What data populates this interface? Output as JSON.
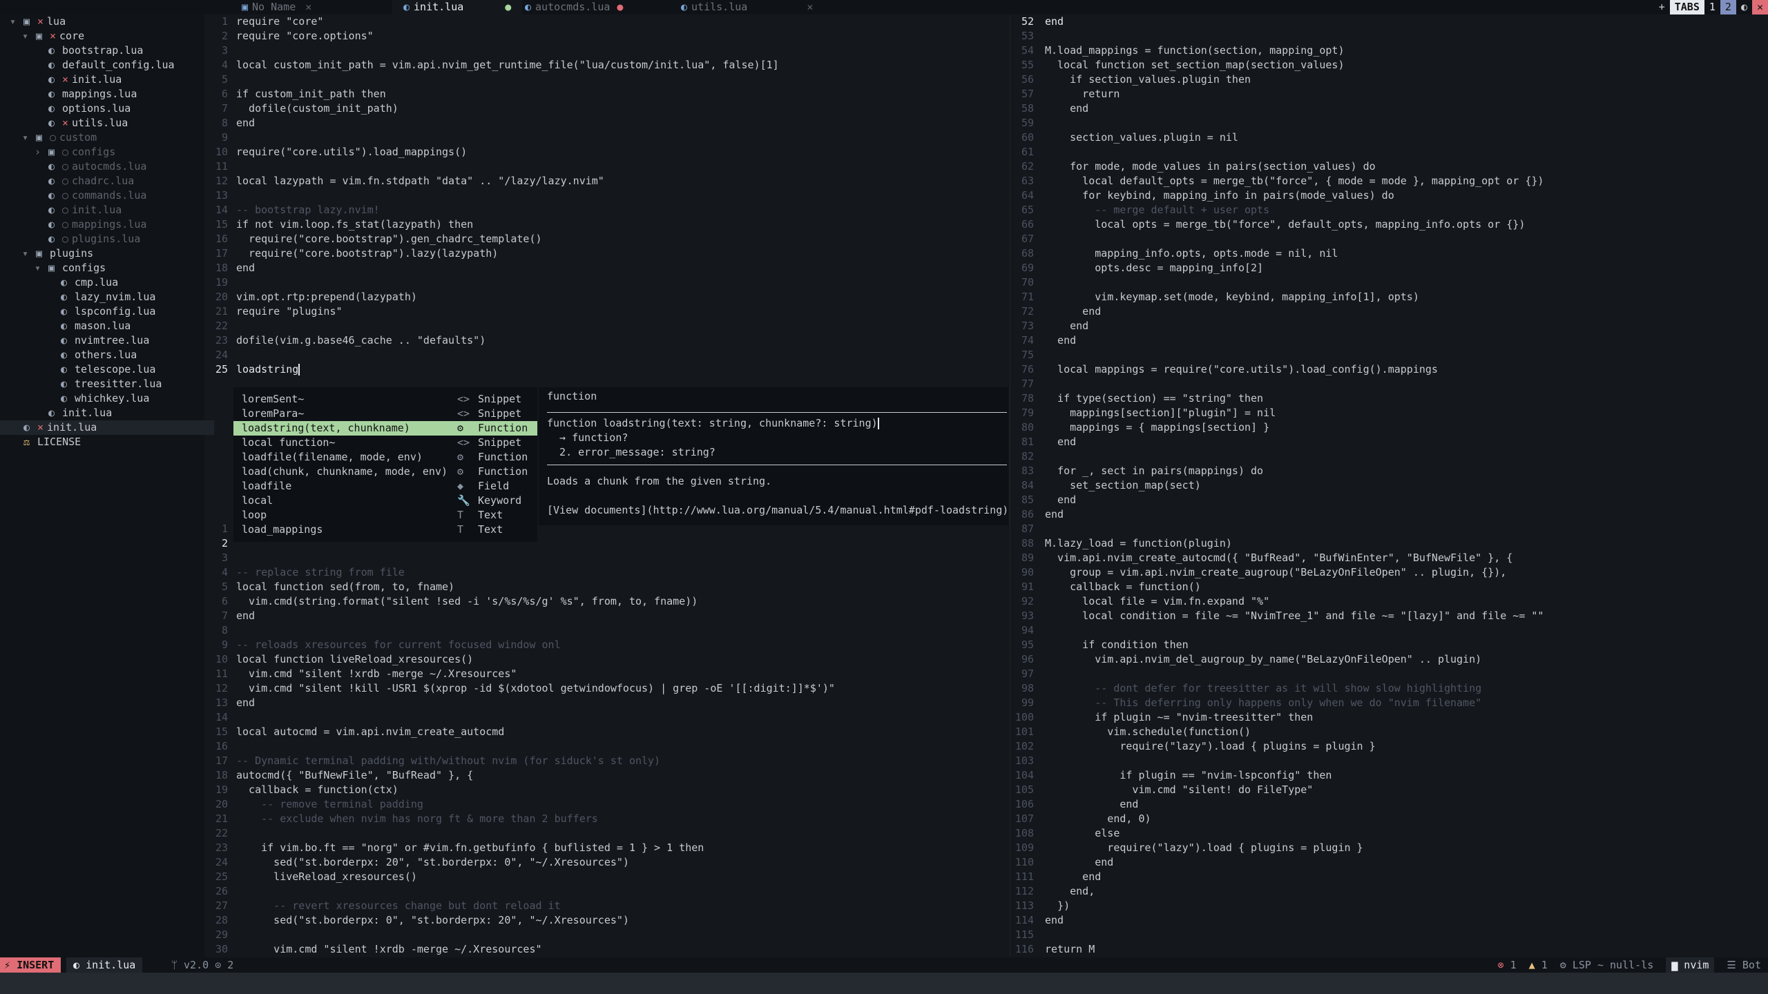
{
  "colors": {
    "background": "#14171c",
    "accent": "#a8d4a0",
    "error": "#e06c75",
    "warning": "#e5c07b",
    "insert_mode": "#e06c75"
  },
  "tabs": [
    {
      "label": "No Name",
      "icon": "empty-file-icon",
      "active": false,
      "modified": false
    },
    {
      "label": "init.lua",
      "icon": "lua-file-icon",
      "active": true,
      "modified": true
    },
    {
      "label": "autocmds.lua",
      "icon": "lua-file-icon",
      "active": false,
      "modified": true
    },
    {
      "label": "utils.lua",
      "icon": "lua-file-icon",
      "active": false,
      "modified": false
    }
  ],
  "tabline_right": {
    "new": "+",
    "tabs": "TABS",
    "tab1": "1",
    "tab2": "2",
    "toggle": "◐",
    "close": "✕"
  },
  "tree": [
    {
      "indent": 0,
      "chev": "▾",
      "icon": "folder-icon",
      "mod": "×",
      "label": "lua",
      "dim": false
    },
    {
      "indent": 1,
      "chev": "▾",
      "icon": "folder-icon",
      "mod": "×",
      "label": "core",
      "dim": false
    },
    {
      "indent": 2,
      "chev": "",
      "icon": "lua-file-icon",
      "mod": "",
      "label": "bootstrap.lua",
      "dim": false
    },
    {
      "indent": 2,
      "chev": "",
      "icon": "lua-file-icon",
      "mod": "",
      "label": "default_config.lua",
      "dim": false
    },
    {
      "indent": 2,
      "chev": "",
      "icon": "lua-file-icon",
      "mod": "×",
      "label": "init.lua",
      "dim": false
    },
    {
      "indent": 2,
      "chev": "",
      "icon": "lua-file-icon",
      "mod": "",
      "label": "mappings.lua",
      "dim": false
    },
    {
      "indent": 2,
      "chev": "",
      "icon": "lua-file-icon",
      "mod": "",
      "label": "options.lua",
      "dim": false
    },
    {
      "indent": 2,
      "chev": "",
      "icon": "lua-file-icon",
      "mod": "×",
      "label": "utils.lua",
      "dim": false
    },
    {
      "indent": 1,
      "chev": "▾",
      "icon": "folder-icon",
      "mod": "○",
      "label": "custom",
      "dim": true
    },
    {
      "indent": 2,
      "chev": "›",
      "icon": "folder-icon",
      "mod": "○",
      "label": "configs",
      "dim": true
    },
    {
      "indent": 2,
      "chev": "",
      "icon": "lua-file-icon",
      "mod": "○",
      "label": "autocmds.lua",
      "dim": true
    },
    {
      "indent": 2,
      "chev": "",
      "icon": "lua-file-icon",
      "mod": "○",
      "label": "chadrc.lua",
      "dim": true
    },
    {
      "indent": 2,
      "chev": "",
      "icon": "lua-file-icon",
      "mod": "○",
      "label": "commands.lua",
      "dim": true
    },
    {
      "indent": 2,
      "chev": "",
      "icon": "lua-file-icon",
      "mod": "○",
      "label": "init.lua",
      "dim": true
    },
    {
      "indent": 2,
      "chev": "",
      "icon": "lua-file-icon",
      "mod": "○",
      "label": "mappings.lua",
      "dim": true
    },
    {
      "indent": 2,
      "chev": "",
      "icon": "lua-file-icon",
      "mod": "○",
      "label": "plugins.lua",
      "dim": true
    },
    {
      "indent": 1,
      "chev": "▾",
      "icon": "folder-icon",
      "mod": "",
      "label": "plugins",
      "dim": false
    },
    {
      "indent": 2,
      "chev": "▾",
      "icon": "folder-icon",
      "mod": "",
      "label": "configs",
      "dim": false
    },
    {
      "indent": 3,
      "chev": "",
      "icon": "lua-file-icon",
      "mod": "",
      "label": "cmp.lua",
      "dim": false
    },
    {
      "indent": 3,
      "chev": "",
      "icon": "lua-file-icon",
      "mod": "",
      "label": "lazy_nvim.lua",
      "dim": false
    },
    {
      "indent": 3,
      "chev": "",
      "icon": "lua-file-icon",
      "mod": "",
      "label": "lspconfig.lua",
      "dim": false
    },
    {
      "indent": 3,
      "chev": "",
      "icon": "lua-file-icon",
      "mod": "",
      "label": "mason.lua",
      "dim": false
    },
    {
      "indent": 3,
      "chev": "",
      "icon": "lua-file-icon",
      "mod": "",
      "label": "nvimtree.lua",
      "dim": false
    },
    {
      "indent": 3,
      "chev": "",
      "icon": "lua-file-icon",
      "mod": "",
      "label": "others.lua",
      "dim": false
    },
    {
      "indent": 3,
      "chev": "",
      "icon": "lua-file-icon",
      "mod": "",
      "label": "telescope.lua",
      "dim": false
    },
    {
      "indent": 3,
      "chev": "",
      "icon": "lua-file-icon",
      "mod": "",
      "label": "treesitter.lua",
      "dim": false
    },
    {
      "indent": 3,
      "chev": "",
      "icon": "lua-file-icon",
      "mod": "",
      "label": "whichkey.lua",
      "dim": false
    },
    {
      "indent": 2,
      "chev": "",
      "icon": "lua-file-icon",
      "mod": "",
      "label": "init.lua",
      "dim": false
    },
    {
      "indent": 0,
      "chev": "",
      "icon": "lua-file-icon",
      "mod": "×",
      "label": "init.lua",
      "dim": false,
      "selected": true
    },
    {
      "indent": 0,
      "chev": "",
      "icon": "license-icon",
      "mod": "",
      "label": "LICENSE",
      "dim": false
    }
  ],
  "editor_top": {
    "lines": [
      {
        "n": "1",
        "text": "require \"core\""
      },
      {
        "n": "2",
        "text": "require \"core.options\""
      },
      {
        "n": "3",
        "text": ""
      },
      {
        "n": "4",
        "text": "local custom_init_path = vim.api.nvim_get_runtime_file(\"lua/custom/init.lua\", false)[1]"
      },
      {
        "n": "5",
        "text": ""
      },
      {
        "n": "6",
        "text": "if custom_init_path then"
      },
      {
        "n": "7",
        "text": "  dofile(custom_init_path)"
      },
      {
        "n": "8",
        "text": "end"
      },
      {
        "n": "9",
        "text": ""
      },
      {
        "n": "10",
        "text": "require(\"core.utils\").load_mappings()"
      },
      {
        "n": "11",
        "text": ""
      },
      {
        "n": "12",
        "text": "local lazypath = vim.fn.stdpath \"data\" .. \"/lazy/lazy.nvim\""
      },
      {
        "n": "13",
        "text": ""
      },
      {
        "n": "14",
        "text": "-- bootstrap lazy.nvim!",
        "comment": true
      },
      {
        "n": "15",
        "text": "if not vim.loop.fs_stat(lazypath) then"
      },
      {
        "n": "16",
        "text": "  require(\"core.bootstrap\").gen_chadrc_template()"
      },
      {
        "n": "17",
        "text": "  require(\"core.bootstrap\").lazy(lazypath)"
      },
      {
        "n": "18",
        "text": "end"
      },
      {
        "n": "19",
        "text": ""
      },
      {
        "n": "20",
        "text": "vim.opt.rtp:prepend(lazypath)"
      },
      {
        "n": "21",
        "text": "require \"plugins\""
      },
      {
        "n": "22",
        "text": ""
      },
      {
        "n": "23",
        "text": "dofile(vim.g.base46_cache .. \"defaults\")"
      },
      {
        "n": "24",
        "text": ""
      },
      {
        "n": "25",
        "text": "loadstring",
        "current": true
      }
    ]
  },
  "editor_bottom": {
    "lines": [
      {
        "n": "1",
        "text": ""
      },
      {
        "n": "2",
        "text": "",
        "current": true
      },
      {
        "n": "3",
        "text": ""
      },
      {
        "n": "4",
        "text": "-- replace string from file",
        "comment": true
      },
      {
        "n": "5",
        "text": "local function sed(from, to, fname)"
      },
      {
        "n": "6",
        "text": "  vim.cmd(string.format(\"silent !sed -i 's/%s/%s/g' %s\", from, to, fname))"
      },
      {
        "n": "7",
        "text": "end"
      },
      {
        "n": "8",
        "text": ""
      },
      {
        "n": "9",
        "text": "-- reloads xresources for current focused window onl",
        "comment": true
      },
      {
        "n": "10",
        "text": "local function liveReload_xresources()"
      },
      {
        "n": "11",
        "text": "  vim.cmd \"silent !xrdb -merge ~/.Xresources\""
      },
      {
        "n": "12",
        "text": "  vim.cmd \"silent !kill -USR1 $(xprop -id $(xdotool getwindowfocus) | grep -oE '[[:digit:]]*$')\""
      },
      {
        "n": "13",
        "text": "end"
      },
      {
        "n": "14",
        "text": ""
      },
      {
        "n": "15",
        "text": "local autocmd = vim.api.nvim_create_autocmd"
      },
      {
        "n": "16",
        "text": ""
      },
      {
        "n": "17",
        "text": "-- Dynamic terminal padding with/without nvim (for siduck's st only)",
        "comment": true
      },
      {
        "n": "18",
        "text": "autocmd({ \"BufNewFile\", \"BufRead\" }, {"
      },
      {
        "n": "19",
        "text": "  callback = function(ctx)"
      },
      {
        "n": "20",
        "text": "    -- remove terminal padding",
        "comment": true
      },
      {
        "n": "21",
        "text": "    -- exclude when nvim has norg ft & more than 2 buffers",
        "comment": true
      },
      {
        "n": "22",
        "text": ""
      },
      {
        "n": "23",
        "text": "    if vim.bo.ft == \"norg\" or #vim.fn.getbufinfo { buflisted = 1 } > 1 then"
      },
      {
        "n": "24",
        "text": "      sed(\"st.borderpx: 20\", \"st.borderpx: 0\", \"~/.Xresources\")"
      },
      {
        "n": "25",
        "text": "      liveReload_xresources()"
      },
      {
        "n": "26",
        "text": ""
      },
      {
        "n": "27",
        "text": "      -- revert xresources change but dont reload it",
        "comment": true
      },
      {
        "n": "28",
        "text": "      sed(\"st.borderpx: 0\", \"st.borderpx: 20\", \"~/.Xresources\")"
      },
      {
        "n": "29",
        "text": ""
      },
      {
        "n": "30",
        "text": "      vim.cmd \"silent !xrdb -merge ~/.Xresources\""
      }
    ]
  },
  "editor_right": {
    "lines": [
      {
        "n": "52",
        "text": "end",
        "current": true
      },
      {
        "n": "53",
        "text": ""
      },
      {
        "n": "54",
        "text": "M.load_mappings = function(section, mapping_opt)"
      },
      {
        "n": "55",
        "text": "  local function set_section_map(section_values)"
      },
      {
        "n": "56",
        "text": "    if section_values.plugin then"
      },
      {
        "n": "57",
        "text": "      return"
      },
      {
        "n": "58",
        "text": "    end"
      },
      {
        "n": "59",
        "text": ""
      },
      {
        "n": "60",
        "text": "    section_values.plugin = nil"
      },
      {
        "n": "61",
        "text": ""
      },
      {
        "n": "62",
        "text": "    for mode, mode_values in pairs(section_values) do"
      },
      {
        "n": "63",
        "text": "      local default_opts = merge_tb(\"force\", { mode = mode }, mapping_opt or {})"
      },
      {
        "n": "64",
        "text": "      for keybind, mapping_info in pairs(mode_values) do"
      },
      {
        "n": "65",
        "text": "        -- merge default + user opts",
        "comment": true
      },
      {
        "n": "66",
        "text": "        local opts = merge_tb(\"force\", default_opts, mapping_info.opts or {})"
      },
      {
        "n": "67",
        "text": ""
      },
      {
        "n": "68",
        "text": "        mapping_info.opts, opts.mode = nil, nil"
      },
      {
        "n": "69",
        "text": "        opts.desc = mapping_info[2]"
      },
      {
        "n": "70",
        "text": ""
      },
      {
        "n": "71",
        "text": "        vim.keymap.set(mode, keybind, mapping_info[1], opts)"
      },
      {
        "n": "72",
        "text": "      end"
      },
      {
        "n": "73",
        "text": "    end"
      },
      {
        "n": "74",
        "text": "  end"
      },
      {
        "n": "75",
        "text": ""
      },
      {
        "n": "76",
        "text": "  local mappings = require(\"core.utils\").load_config().mappings"
      },
      {
        "n": "77",
        "text": ""
      },
      {
        "n": "78",
        "text": "  if type(section) == \"string\" then"
      },
      {
        "n": "79",
        "text": "    mappings[section][\"plugin\"] = nil"
      },
      {
        "n": "80",
        "text": "    mappings = { mappings[section] }"
      },
      {
        "n": "81",
        "text": "  end"
      },
      {
        "n": "82",
        "text": ""
      },
      {
        "n": "83",
        "text": "  for _, sect in pairs(mappings) do"
      },
      {
        "n": "84",
        "text": "    set_section_map(sect)"
      },
      {
        "n": "85",
        "text": "  end"
      },
      {
        "n": "86",
        "text": "end"
      },
      {
        "n": "87",
        "text": ""
      },
      {
        "n": "88",
        "text": "M.lazy_load = function(plugin)"
      },
      {
        "n": "89",
        "text": "  vim.api.nvim_create_autocmd({ \"BufRead\", \"BufWinEnter\", \"BufNewFile\" }, {"
      },
      {
        "n": "90",
        "text": "    group = vim.api.nvim_create_augroup(\"BeLazyOnFileOpen\" .. plugin, {}),"
      },
      {
        "n": "91",
        "text": "    callback = function()"
      },
      {
        "n": "92",
        "text": "      local file = vim.fn.expand \"%\""
      },
      {
        "n": "93",
        "text": "      local condition = file ~= \"NvimTree_1\" and file ~= \"[lazy]\" and file ~= \"\""
      },
      {
        "n": "94",
        "text": ""
      },
      {
        "n": "95",
        "text": "      if condition then"
      },
      {
        "n": "96",
        "text": "        vim.api.nvim_del_augroup_by_name(\"BeLazyOnFileOpen\" .. plugin)"
      },
      {
        "n": "97",
        "text": ""
      },
      {
        "n": "98",
        "text": "        -- dont defer for treesitter as it will show slow highlighting",
        "comment": true
      },
      {
        "n": "99",
        "text": "        -- This deferring only happens only when we do \"nvim filename\"",
        "comment": true
      },
      {
        "n": "100",
        "text": "        if plugin ~= \"nvim-treesitter\" then"
      },
      {
        "n": "101",
        "text": "          vim.schedule(function()"
      },
      {
        "n": "102",
        "text": "            require(\"lazy\").load { plugins = plugin }"
      },
      {
        "n": "103",
        "text": ""
      },
      {
        "n": "104",
        "text": "            if plugin == \"nvim-lspconfig\" then"
      },
      {
        "n": "105",
        "text": "              vim.cmd \"silent! do FileType\""
      },
      {
        "n": "106",
        "text": "            end"
      },
      {
        "n": "107",
        "text": "          end, 0)"
      },
      {
        "n": "108",
        "text": "        else"
      },
      {
        "n": "109",
        "text": "          require(\"lazy\").load { plugins = plugin }"
      },
      {
        "n": "110",
        "text": "        end"
      },
      {
        "n": "111",
        "text": "      end"
      },
      {
        "n": "112",
        "text": "    end,"
      },
      {
        "n": "113",
        "text": "  })"
      },
      {
        "n": "114",
        "text": "end"
      },
      {
        "n": "115",
        "text": ""
      },
      {
        "n": "116",
        "text": "return M"
      }
    ]
  },
  "completion": {
    "items": [
      {
        "label": "loremSent~",
        "kind_icon": "<>",
        "kind": "Snippet",
        "selected": false
      },
      {
        "label": "loremPara~",
        "kind_icon": "<>",
        "kind": "Snippet",
        "selected": false
      },
      {
        "label": "loadstring(text, chunkname)",
        "kind_icon": "⚙",
        "kind": "Function",
        "selected": true
      },
      {
        "label": "local function~",
        "kind_icon": "<>",
        "kind": "Snippet",
        "selected": false
      },
      {
        "label": "loadfile(filename, mode, env)",
        "kind_icon": "⚙",
        "kind": "Function",
        "selected": false
      },
      {
        "label": "load(chunk, chunkname, mode, env)",
        "kind_icon": "⚙",
        "kind": "Function",
        "selected": false
      },
      {
        "label": "loadfile",
        "kind_icon": "◆",
        "kind": "Field",
        "selected": false
      },
      {
        "label": "local",
        "kind_icon": "🔧",
        "kind": "Keyword",
        "selected": false
      },
      {
        "label": "loop",
        "kind_icon": "T",
        "kind": "Text",
        "selected": false
      },
      {
        "label": "load_mappings",
        "kind_icon": "T",
        "kind": "Text",
        "selected": false
      }
    ],
    "doc": {
      "header": "function",
      "signature": "function loadstring(text: string, chunkname?: string)",
      "ret1": "  → function?",
      "ret2": "  2. error_message: string?",
      "description": "Loads a chunk from the given string.",
      "link": "[View documents](http://www.lua.org/manual/5.4/manual.html#pdf-loadstring)"
    }
  },
  "statusline": {
    "mode": "INSERT",
    "file": "init.lua",
    "branch": "v2.0",
    "changes": "2",
    "errors": "1",
    "warnings": "1",
    "lsp": "LSP ~ null-ls",
    "cwd": "nvim",
    "position": "Bot"
  }
}
